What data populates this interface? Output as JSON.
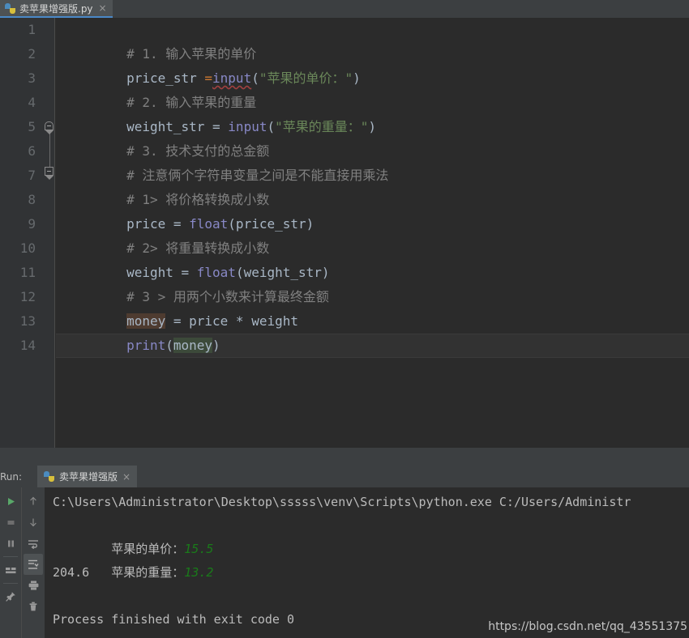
{
  "window": {
    "theme_bg": "#2b2b2b",
    "panel_bg": "#3c3f41",
    "accent": "#4a88c7"
  },
  "editor_tab": {
    "icon": "python-file-icon",
    "title": "卖苹果增强版.py",
    "close": "×"
  },
  "editor": {
    "line_numbers": [
      "1",
      "2",
      "3",
      "4",
      "5",
      "6",
      "7",
      "8",
      "9",
      "10",
      "11",
      "12",
      "13",
      "14"
    ],
    "lines": [
      {
        "n": 1,
        "plain": "# 1. 输入苹果的单价"
      },
      {
        "n": 2,
        "plain": "price_str =input(\"苹果的单价：\")"
      },
      {
        "n": 3,
        "plain": "# 2. 输入苹果的重量"
      },
      {
        "n": 4,
        "plain": "weight_str = input(\"苹果的重量：\")"
      },
      {
        "n": 5,
        "plain": "# 3. 技术支付的总金额"
      },
      {
        "n": 6,
        "plain": "# 注意俩个字符串变量之间是不能直接用乘法"
      },
      {
        "n": 7,
        "plain": "# 1> 将价格转换成小数"
      },
      {
        "n": 8,
        "plain": "price = float(price_str)"
      },
      {
        "n": 9,
        "plain": "# 2> 将重量转换成小数"
      },
      {
        "n": 10,
        "plain": "weight = float(weight_str)"
      },
      {
        "n": 11,
        "plain": "# 3 > 用两个小数来计算最终金额"
      },
      {
        "n": 12,
        "plain": "money = price * weight"
      },
      {
        "n": 13,
        "plain": "print(money)"
      },
      {
        "n": 14,
        "plain": ""
      }
    ],
    "tokens": {
      "l1_comment": "# 1. 输入苹果的单价",
      "l2_var": "price_str ",
      "l2_eq": "=",
      "l2_fn": "input",
      "l2_paren_open": "(",
      "l2_string": "\"苹果的单价：\"",
      "l2_paren_close": ")",
      "l3_comment": "# 2. 输入苹果的重量",
      "l4_var": "weight_str = ",
      "l4_fn": "input",
      "l4_paren_open": "(",
      "l4_string": "\"苹果的重量：\"",
      "l4_paren_close": ")",
      "l5_comment": "# 3. 技术支付的总金额",
      "l6_comment": "# 注意俩个字符串变量之间是不能直接用乘法",
      "l7_comment": "# 1> 将价格转换成小数",
      "l8_var": "price = ",
      "l8_fn": "float",
      "l8_args": "(price_str)",
      "l9_comment": "# 2> 将重量转换成小数",
      "l10_var": "weight = ",
      "l10_fn": "float",
      "l10_args": "(weight_str)",
      "l11_comment": "# 3 > 用两个小数来计算最终金额",
      "l12_money": "money",
      "l12_rest": " = price * weight",
      "l13_fn": "print",
      "l13_paren_open": "(",
      "l13_money": "money",
      "l13_paren_close": ")"
    },
    "fold_markers": [
      {
        "line": 5,
        "type": "collapse-start"
      },
      {
        "line": 7,
        "type": "collapse-end"
      }
    ],
    "caret_line": 14,
    "highlight_write_color": "#4e3b30",
    "highlight_read_color": "#3c4a3a",
    "colors": {
      "comment": "#808080",
      "string": "#6a8759",
      "function": "#8888c6",
      "identifier": "#a9b7c6",
      "keyword": "#cc7832"
    }
  },
  "run_panel": {
    "label": "Run:",
    "tab": {
      "icon": "python-run-icon",
      "title": "卖苹果增强版",
      "close": "×"
    },
    "toolbar_left": [
      {
        "name": "rerun-button",
        "icon": "play-icon"
      },
      {
        "name": "stop-button",
        "icon": "stop-icon"
      },
      {
        "name": "pause-button",
        "icon": "pause-icon"
      },
      {
        "name": "restore-layout-button",
        "icon": "layout-icon"
      },
      {
        "name": "pin-tab-button",
        "icon": "pin-icon"
      }
    ],
    "toolbar_right": [
      {
        "name": "up-button",
        "icon": "arrow-up-icon"
      },
      {
        "name": "down-button",
        "icon": "arrow-down-icon"
      },
      {
        "name": "soft-wrap-button",
        "icon": "soft-wrap-icon"
      },
      {
        "name": "scroll-to-end-button",
        "icon": "scroll-to-end-icon",
        "selected": true
      },
      {
        "name": "print-button",
        "icon": "print-icon"
      },
      {
        "name": "clear-all-button",
        "icon": "trash-icon"
      }
    ],
    "console": {
      "command_line": "C:\\Users\\Administrator\\Desktop\\sssss\\venv\\Scripts\\python.exe C:/Users/Administr",
      "prompt_price_label": "苹果的单价：",
      "prompt_price_value": "15.5",
      "prompt_weight_label": "苹果的重量：",
      "prompt_weight_value": "13.2",
      "result": "204.6",
      "exit_message": "Process finished with exit code 0",
      "input_color": "#1a7a1a",
      "text_color": "#bbbbbb"
    }
  },
  "watermark": {
    "text": "https://blog.csdn.net/qq_43551375"
  }
}
